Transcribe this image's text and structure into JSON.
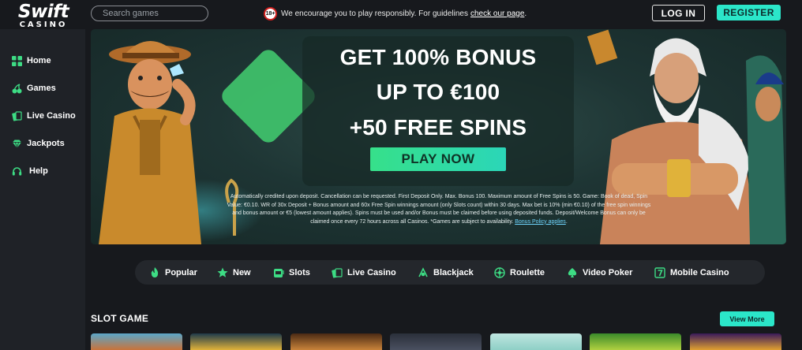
{
  "header": {
    "logo_line1": "Swift",
    "logo_line2": "CASINO",
    "search_placeholder": "Search games",
    "age_badge": "18+",
    "notice_text": "We encourage you to play responsibly. For guidelines",
    "notice_link": "check our page",
    "notice_end": ".",
    "login_label": "LOG IN",
    "register_label": "REGISTER"
  },
  "sidebar": {
    "items": [
      {
        "label": "Home",
        "icon": "home-grid-icon"
      },
      {
        "label": "Games",
        "icon": "cherries-icon"
      },
      {
        "label": "Live Casino",
        "icon": "live-cards-icon"
      },
      {
        "label": "Jackpots",
        "icon": "diamond-icon"
      },
      {
        "label": "Help",
        "icon": "headset-icon"
      }
    ]
  },
  "banner": {
    "line1": "GET 100% BONUS",
    "line2": "UP TO €100",
    "line3": "+50 FREE SPINS",
    "cta": "PLAY NOW",
    "terms": "Automatically credited upon deposit. Cancellation can be requested. First Deposit Only. Max. Bonus 100. Maximum amount of Free Spins is 50. Game: Book of dead, Spin Value: €0.10. WR of 30x Deposit + Bonus amount and 60x Free Spin winnings amount (only Slots count) within 30 days. Max bet is 10% (min €0.10) of the free spin winnings and bonus amount or €5 (lowest amount applies). Spins must be used and/or Bonus must be claimed before using deposited funds. Deposit/Welcome Bonus can only be claimed once every 72 hours across all Casinos. *Games are subject to availability.",
    "terms_link": "Bonus Policy applies",
    "terms_end": "."
  },
  "categories": [
    {
      "label": "Popular",
      "icon": "flame-icon"
    },
    {
      "label": "New",
      "icon": "star-icon"
    },
    {
      "label": "Slots",
      "icon": "slot-machine-icon"
    },
    {
      "label": "Live Casino",
      "icon": "live-cards-icon"
    },
    {
      "label": "Blackjack",
      "icon": "blackjack-icon"
    },
    {
      "label": "Roulette",
      "icon": "roulette-icon"
    },
    {
      "label": "Video Poker",
      "icon": "spade-icon"
    },
    {
      "label": "Mobile Casino",
      "icon": "mobile-seven-icon"
    }
  ],
  "slot_section": {
    "title": "SLOT GAME",
    "view_more": "View More"
  },
  "colors": {
    "accent": "#2be6c9",
    "icon_green": "#3ddc84",
    "background": "#17191d",
    "sidebar": "#1f2227"
  }
}
